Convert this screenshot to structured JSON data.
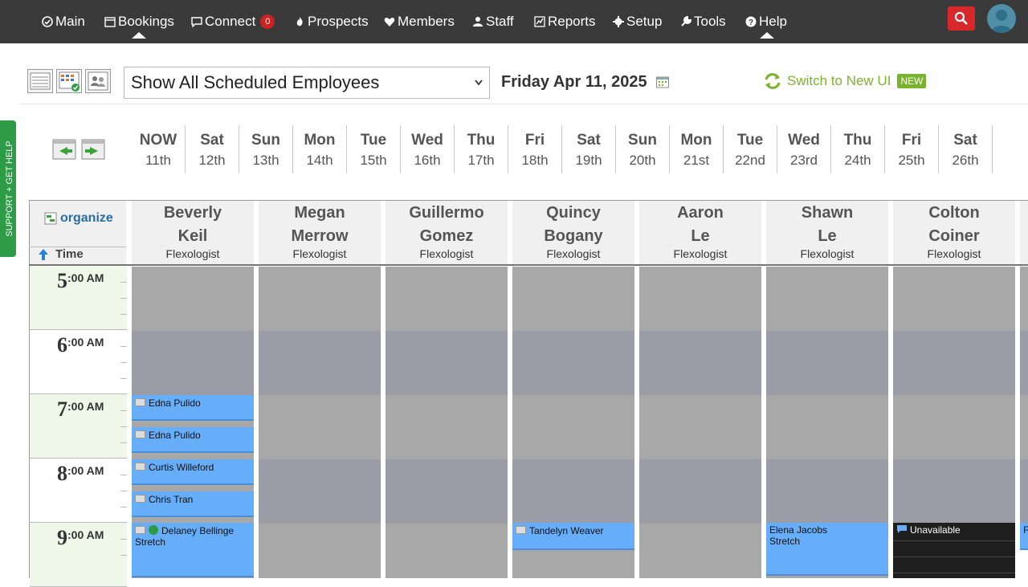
{
  "nav": {
    "items": [
      {
        "label": "Main",
        "icon": "main-icon"
      },
      {
        "label": "Bookings",
        "icon": "bookings-icon"
      },
      {
        "label": "Connect",
        "icon": "connect-icon",
        "badge": "0"
      },
      {
        "label": "Prospects",
        "icon": "prospects-icon"
      },
      {
        "label": "Members",
        "icon": "heart-icon"
      },
      {
        "label": "Staff",
        "icon": "staff-icon"
      },
      {
        "label": "Reports",
        "icon": "reports-icon"
      },
      {
        "label": "Setup",
        "icon": "gear-icon"
      },
      {
        "label": "Tools",
        "icon": "wrench-icon"
      },
      {
        "label": "Help",
        "icon": "help-icon"
      }
    ]
  },
  "toolbar": {
    "employee_filter": "Show All Scheduled Employees",
    "current_date": "Friday Apr 11, 2025",
    "switch_ui_label": "Switch to New UI",
    "new_badge": "NEW"
  },
  "support_tab": "SUPPORT + GET HELP",
  "days": [
    {
      "name": "NOW",
      "date": "11th"
    },
    {
      "name": "Sat",
      "date": "12th"
    },
    {
      "name": "Sun",
      "date": "13th"
    },
    {
      "name": "Mon",
      "date": "14th"
    },
    {
      "name": "Tue",
      "date": "15th"
    },
    {
      "name": "Wed",
      "date": "16th"
    },
    {
      "name": "Thu",
      "date": "17th"
    },
    {
      "name": "Fri",
      "date": "18th"
    },
    {
      "name": "Sat",
      "date": "19th"
    },
    {
      "name": "Sun",
      "date": "20th"
    },
    {
      "name": "Mon",
      "date": "21st"
    },
    {
      "name": "Tue",
      "date": "22nd"
    },
    {
      "name": "Wed",
      "date": "23rd"
    },
    {
      "name": "Thu",
      "date": "24th"
    },
    {
      "name": "Fri",
      "date": "25th"
    },
    {
      "name": "Sat",
      "date": "26th"
    }
  ],
  "grid": {
    "organize_label": "organize",
    "time_label": "Time",
    "hours": [
      {
        "h": "5",
        "m": ":00 AM"
      },
      {
        "h": "6",
        "m": ":00 AM"
      },
      {
        "h": "7",
        "m": ":00 AM"
      },
      {
        "h": "8",
        "m": ":00 AM"
      },
      {
        "h": "9",
        "m": ":00 AM"
      }
    ],
    "employees": [
      {
        "first": "Beverly",
        "last": "Keil",
        "role": "Flexologist"
      },
      {
        "first": "Megan",
        "last": "Merrow",
        "role": "Flexologist"
      },
      {
        "first": "Guillermo",
        "last": "Gomez",
        "role": "Flexologist"
      },
      {
        "first": "Quincy",
        "last": "Bogany",
        "role": "Flexologist"
      },
      {
        "first": "Aaron",
        "last": "Le",
        "role": "Flexologist"
      },
      {
        "first": "Shawn",
        "last": "Le",
        "role": "Flexologist"
      },
      {
        "first": "Colton",
        "last": "Coiner",
        "role": "Flexologist"
      }
    ]
  },
  "appointments": {
    "beverly": [
      {
        "name": "Edna Pulido"
      },
      {
        "name": "Edna Pulido"
      },
      {
        "name": "Curtis Willeford"
      },
      {
        "name": "Chris Tran"
      },
      {
        "name": "Delaney Bellinge",
        "service": "Stretch",
        "checked_in": true
      }
    ],
    "quincy": [
      {
        "name": "Tandelyn Weaver"
      }
    ],
    "shawn": [
      {
        "name": "Elena Jacobs",
        "service": "Stretch"
      }
    ],
    "colton": [
      {
        "name": "Unavailable"
      }
    ],
    "partial_label": "F"
  },
  "colors": {
    "nav_bg": "#3a3a3a",
    "appointment": "#66aef9",
    "accent_green": "#7ab32e",
    "search_red": "#d9282c"
  }
}
